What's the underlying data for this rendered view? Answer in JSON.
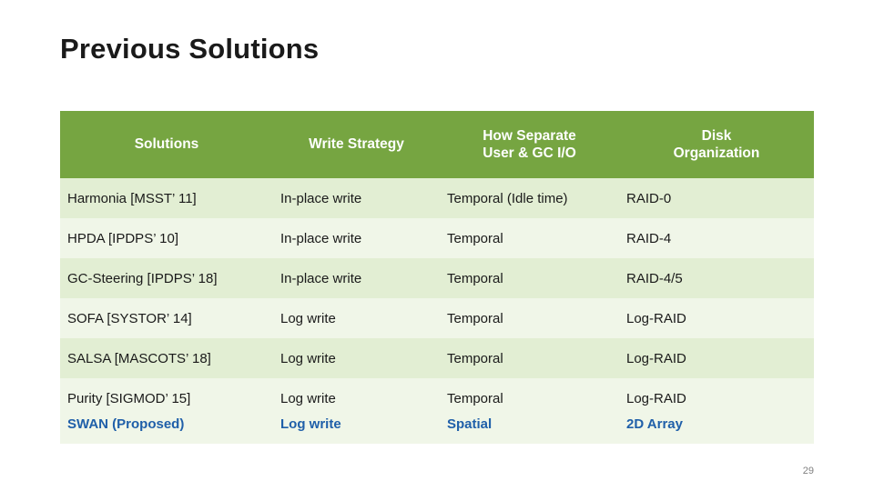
{
  "slide": {
    "title": "Previous Solutions",
    "page_number": "29"
  },
  "table": {
    "headers": [
      "Solutions",
      "Write Strategy",
      "How Separate\nUser & GC I/O",
      "Disk\nOrganization"
    ],
    "header_line1": [
      "Solutions",
      "Write Strategy",
      "How Separate",
      "Disk"
    ],
    "header_line2": [
      "",
      "",
      "User & GC I/O",
      "Organization"
    ],
    "rows": [
      {
        "solution": "Harmonia [MSST’ 11]",
        "write_strategy": "In-place write",
        "separation": "Temporal (Idle time)",
        "disk_org": "RAID-0",
        "highlight": false
      },
      {
        "solution": "HPDA [IPDPS’ 10]",
        "write_strategy": "In-place write",
        "separation": "Temporal",
        "disk_org": "RAID-4",
        "highlight": false
      },
      {
        "solution": "GC-Steering [IPDPS’ 18]",
        "write_strategy": "In-place write",
        "separation": "Temporal",
        "disk_org": "RAID-4/5",
        "highlight": false
      },
      {
        "solution": "SOFA [SYSTOR’ 14]",
        "write_strategy": "Log write",
        "separation": "Temporal",
        "disk_org": "Log-RAID",
        "highlight": false
      },
      {
        "solution": "SALSA [MASCOTS’ 18]",
        "write_strategy": "Log write",
        "separation": "Temporal",
        "disk_org": "Log-RAID",
        "highlight": false
      },
      {
        "solution": "Purity [SIGMOD’ 15]",
        "write_strategy": "Log write",
        "separation": "Temporal",
        "disk_org": "Log-RAID",
        "highlight": false
      },
      {
        "solution": "SWAN (Proposed)",
        "write_strategy": "Log write",
        "separation": "Spatial",
        "disk_org": "2D Array",
        "highlight": true
      }
    ]
  },
  "colors": {
    "header_bg": "#76a541",
    "row_odd_bg": "#e2eed3",
    "row_even_bg": "#f0f6e8",
    "highlight_text": "#1f5fa9",
    "title_text": "#1a1a1a"
  }
}
